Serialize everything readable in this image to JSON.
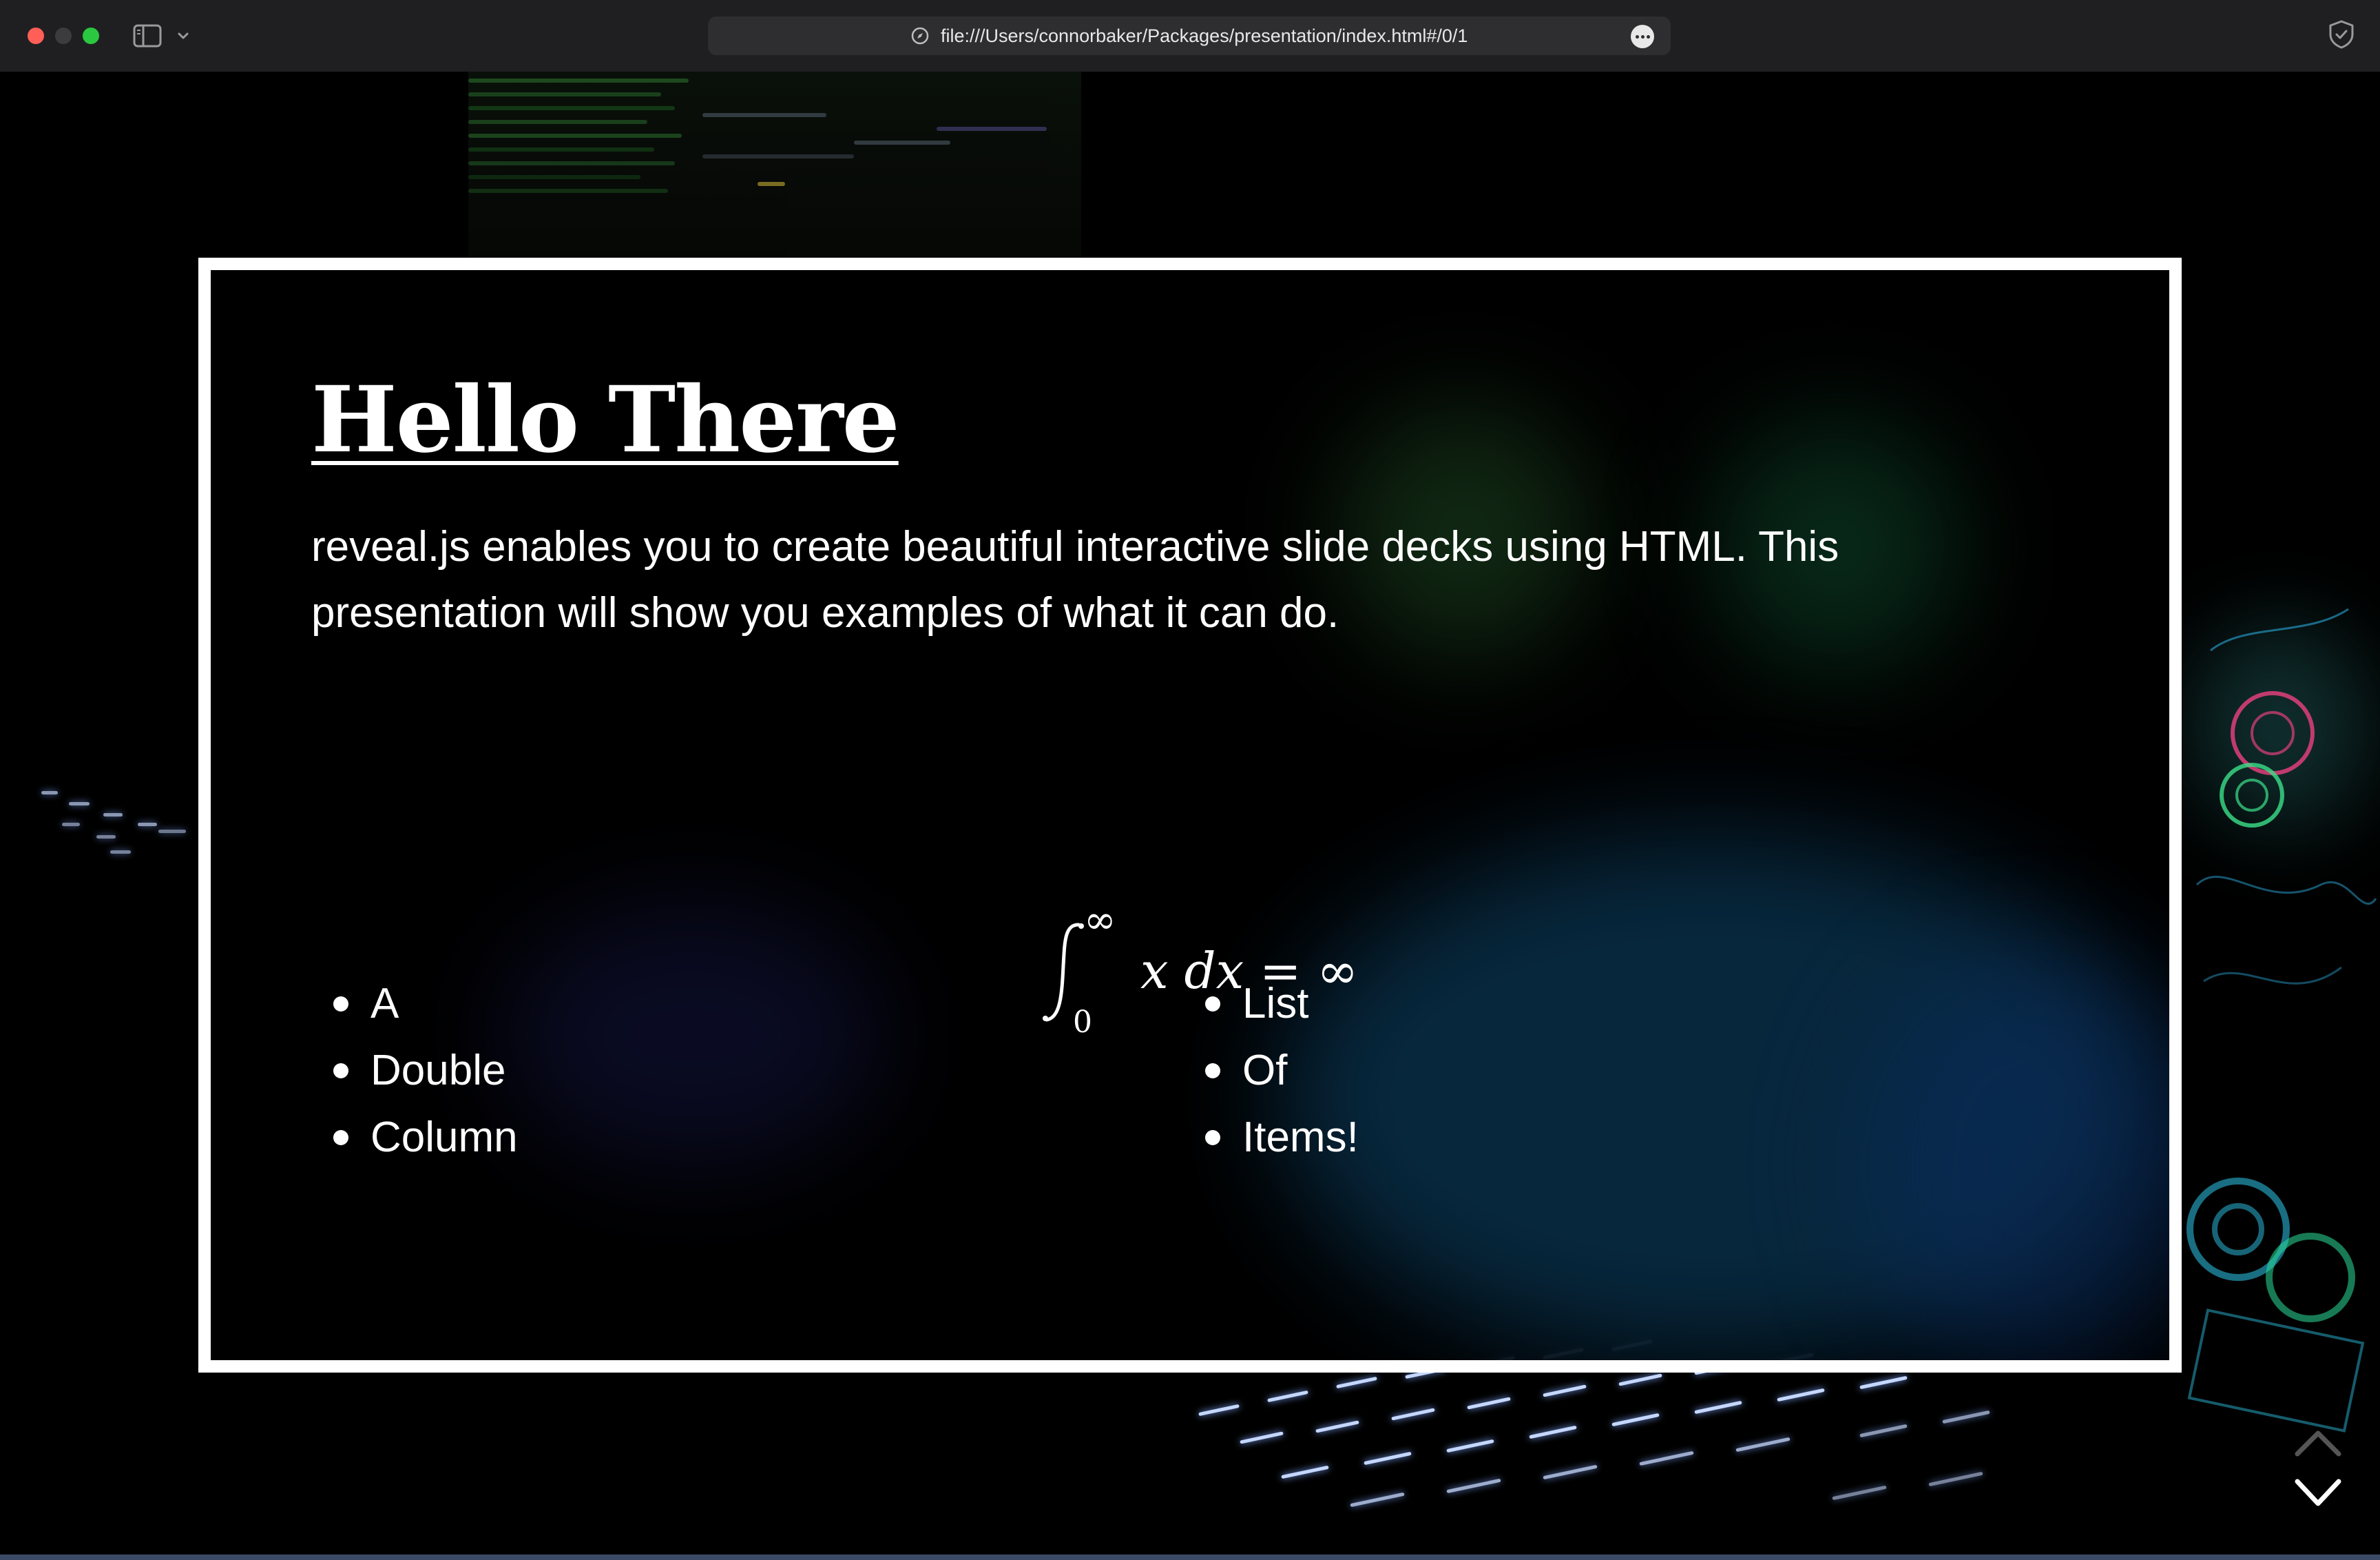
{
  "browser": {
    "url": "file:///Users/connorbaker/Packages/presentation/index.html#/0/1",
    "icons": {
      "close": "close-dot",
      "minimize": "minimize-dot",
      "zoom": "zoom-dot",
      "sidebar": "sidebar-icon",
      "tab_overview": "chevron-down-icon",
      "site": "compass-icon",
      "page_menu": "more-icon",
      "privacy": "shield-icon"
    }
  },
  "slide": {
    "title": "Hello There",
    "paragraph": "reveal.js enables you to create beautiful interactive slide decks using HTML. This presentation will show you examples of what it can do.",
    "math": {
      "lower": "0",
      "upper": "∞",
      "body": "x dx = ∞"
    },
    "left_column": [
      "A",
      "Double",
      "Column"
    ],
    "right_column": [
      "List",
      "Of",
      "Items!"
    ]
  },
  "navigation": {
    "up": "chevron-up-icon",
    "down": "chevron-down-icon"
  },
  "colors": {
    "chrome_bg": "#1f1f21",
    "urlbar_bg": "#2e2e31",
    "slide_border": "#ffffff",
    "slide_text": "#ffffff"
  }
}
